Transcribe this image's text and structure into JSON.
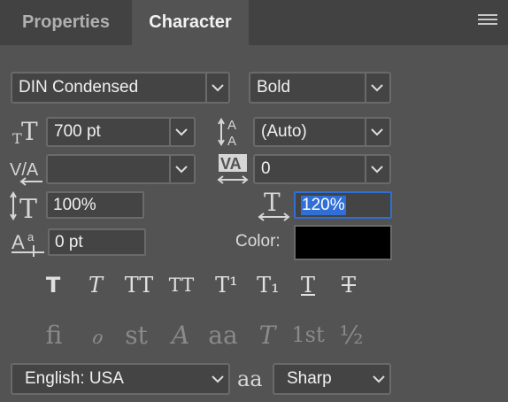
{
  "tabs": {
    "properties": "Properties",
    "character": "Character"
  },
  "font": {
    "family": "DIN Condensed",
    "style": "Bold"
  },
  "size": {
    "value": "700 pt"
  },
  "leading": {
    "value": "(Auto)"
  },
  "kerning": {
    "value": ""
  },
  "tracking": {
    "value": "0"
  },
  "vertical_scale": {
    "value": "100%"
  },
  "horizontal_scale": {
    "value": "120%"
  },
  "baseline_shift": {
    "value": "0 pt"
  },
  "color": {
    "label": "Color:",
    "swatch": "#000000"
  },
  "language": {
    "value": "English: USA"
  },
  "antialias": {
    "icon_text": "aa",
    "value": "Sharp"
  },
  "style_buttons": [
    "T",
    "T",
    "TT",
    "TT",
    "T¹",
    "T₁",
    "T",
    "T"
  ],
  "opentype_buttons": [
    "fi",
    "ℴ",
    "st",
    "A",
    "aa",
    "T",
    "1st",
    "½"
  ],
  "accent": {
    "selection": "#2f6fd6"
  }
}
